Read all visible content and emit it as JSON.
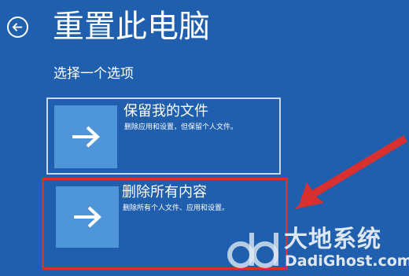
{
  "header": {
    "back_icon": "arrow-left-circle-icon",
    "title": "重置此电脑"
  },
  "subtitle": "选择一个选项",
  "options": [
    {
      "title": "保留我的文件",
      "description": "删除应用和设置，但保留个人文件。",
      "icon": "arrow-right-icon"
    },
    {
      "title": "删除所有内容",
      "description": "删除所有个人文件、应用和设置。",
      "icon": "arrow-right-icon"
    }
  ],
  "annotation": {
    "highlight_color": "#d82f2f",
    "pointer_icon": "red-arrow-icon"
  },
  "watermark": {
    "brand": "大地系统",
    "url": "DadiGhost.com"
  },
  "colors": {
    "background": "#1f5fae",
    "tile": "#4e95d9",
    "text": "#ffffff"
  }
}
